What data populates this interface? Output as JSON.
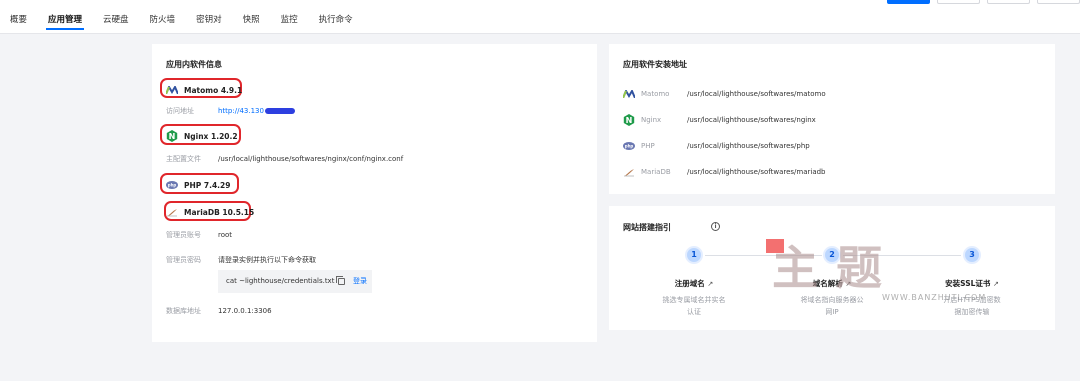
{
  "tabs": [
    "概要",
    "应用管理",
    "云硬盘",
    "防火墙",
    "密钥对",
    "快照",
    "监控",
    "执行命令"
  ],
  "active_tab": "应用管理",
  "software_card": {
    "title": "应用内软件信息",
    "matomo": {
      "name": "Matomo 4.9.1",
      "url_label": "访问地址",
      "url_value": "http://43.130"
    },
    "nginx": {
      "name": "Nginx 1.20.2",
      "config_label": "主配置文件",
      "config_value": "/usr/local/lighthouse/softwares/nginx/conf/nginx.conf"
    },
    "php": {
      "name": "PHP 7.4.29"
    },
    "mariadb": {
      "name": "MariaDB 10.5.15",
      "account_label": "管理员账号",
      "account_value": "root",
      "password_label": "管理员密码",
      "password_value": "请登录实例并执行以下命令获取",
      "command": "cat ~lighthouse/credentials.txt",
      "login_link": "登录",
      "db_label": "数据库地址",
      "db_value": "127.0.0.1:3306"
    }
  },
  "path_card": {
    "title": "应用软件安装地址",
    "rows": [
      {
        "name": "Matomo",
        "path": "/usr/local/lighthouse/softwares/matomo",
        "icon": "matomo-icon"
      },
      {
        "name": "Nginx",
        "path": "/usr/local/lighthouse/softwares/nginx",
        "icon": "nginx-icon"
      },
      {
        "name": "PHP",
        "path": "/usr/local/lighthouse/softwares/php",
        "icon": "php-icon"
      },
      {
        "name": "MariaDB",
        "path": "/usr/local/lighthouse/softwares/mariadb",
        "icon": "mariadb-icon"
      }
    ]
  },
  "guide_card": {
    "title": "网站搭建指引",
    "steps": [
      {
        "num": "1",
        "title": "注册域名",
        "desc1": "挑选专属域名并实名",
        "desc2": "认证"
      },
      {
        "num": "2",
        "title": "域名解析",
        "desc1": "将域名指向服务器公",
        "desc2": "网IP"
      },
      {
        "num": "3",
        "title": "安装SSL证书",
        "desc1": "开启HTTPS加密数",
        "desc2": "据加密传输"
      }
    ]
  },
  "watermark": {
    "text": "主题",
    "url": "WWW.BANZHUTI.COM"
  },
  "colors": {
    "accent": "#006eff",
    "highlight": "#e0262b",
    "step": "#bcd7ff"
  }
}
